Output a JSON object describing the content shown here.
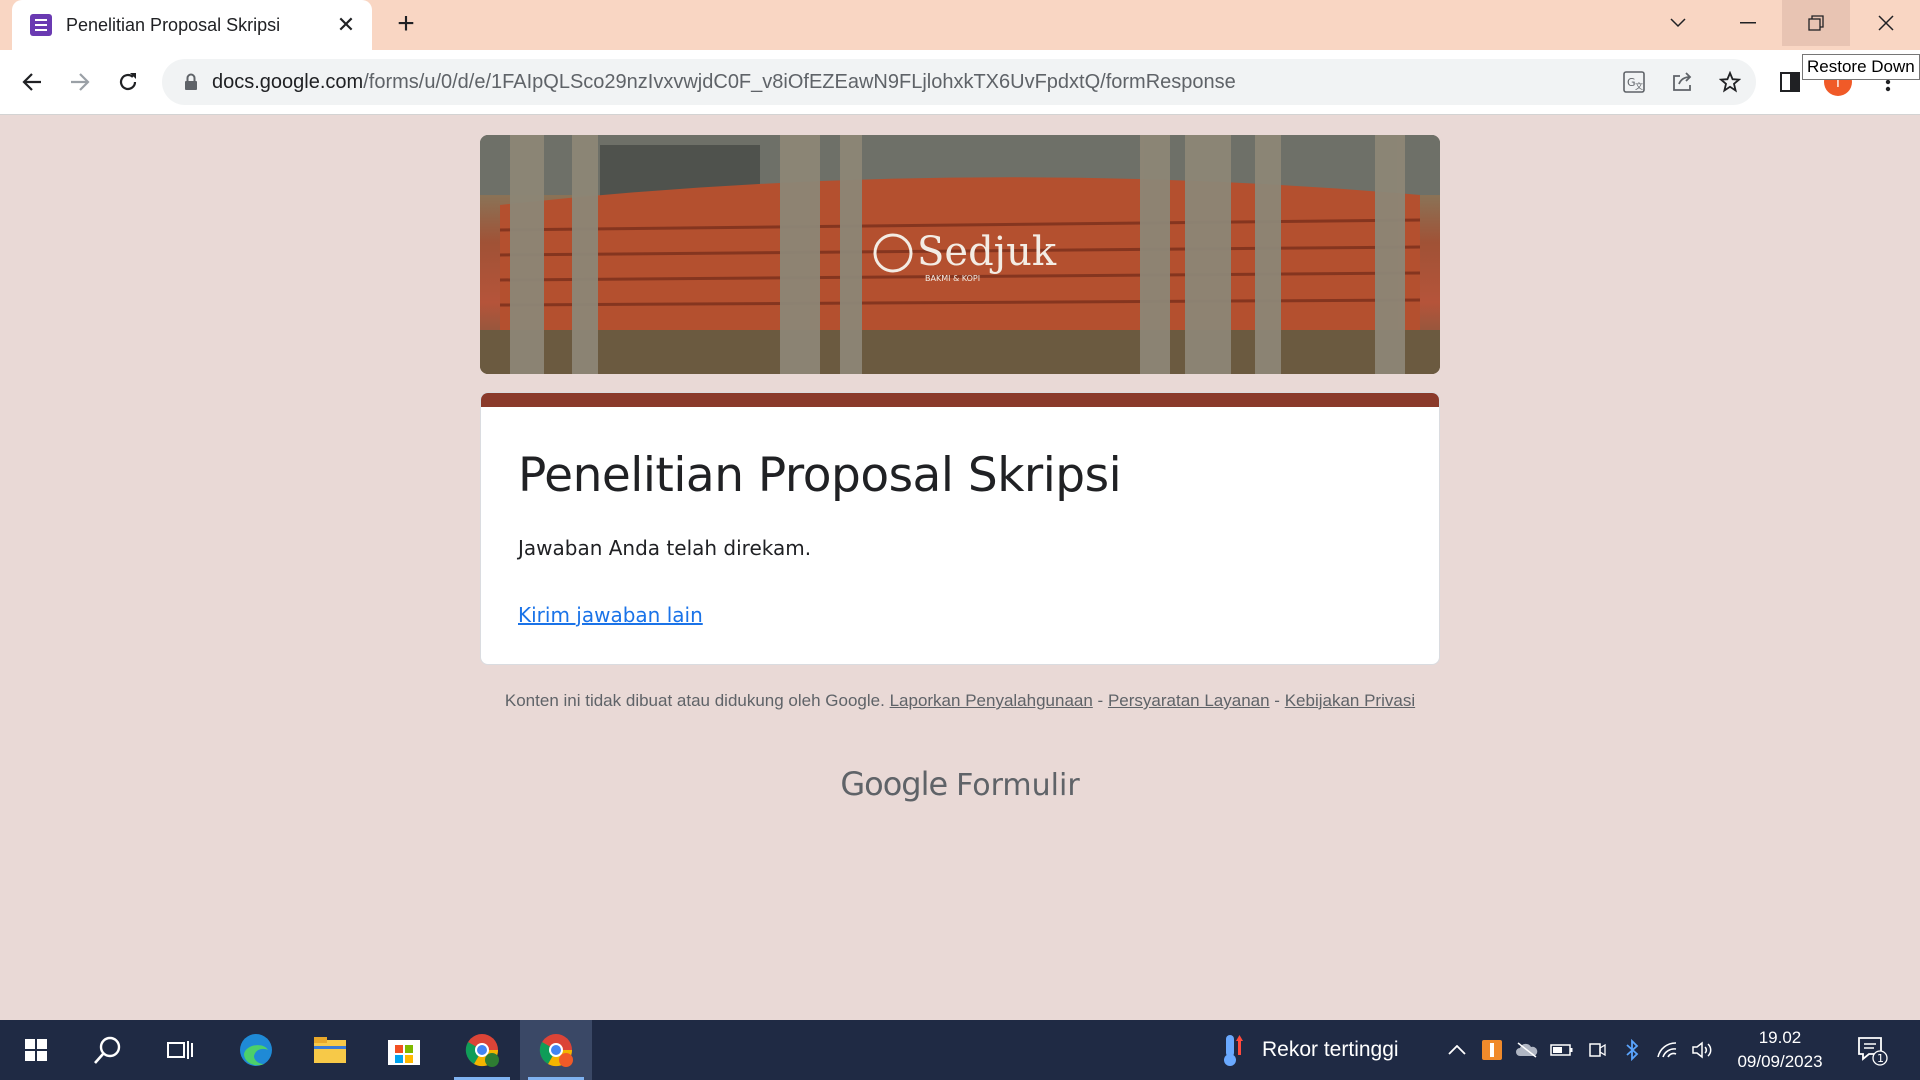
{
  "browser": {
    "tab_title": "Penelitian Proposal Skripsi",
    "url_host": "docs.google.com",
    "url_path": "/forms/u/0/d/e/1FAIpQLSco29nzIvxvwjdC0F_v8iOfEZEawN9FLjlohxkTX6UvFpdxtQ/formResponse",
    "tooltip": "Restore Down",
    "profile_initial": "I"
  },
  "form": {
    "banner_text": "Sedjuk",
    "banner_subtext": "BAKMI & KOPI",
    "title": "Penelitian Proposal Skripsi",
    "confirmation": "Jawaban Anda telah direkam.",
    "submit_another": "Kirim jawaban lain"
  },
  "footer": {
    "disclaimer": "Konten ini tidak dibuat atau didukung oleh Google.",
    "report_abuse": "Laporkan Penyalahgunaan",
    "separator": "-",
    "terms": "Persyaratan Layanan",
    "privacy": "Kebijakan Privasi",
    "logo_google": "Google",
    "logo_product": "Formulir"
  },
  "taskbar": {
    "weather_text": "Rekor tertinggi",
    "time": "19.02",
    "date": "09/09/2023",
    "notification_count": "1"
  },
  "colors": {
    "accent": "#8a3a2b",
    "page_bg": "#e9d9d6",
    "link": "#1a73e8",
    "titlebar": "#f9d6c3",
    "taskbar": "#1f2a44"
  }
}
